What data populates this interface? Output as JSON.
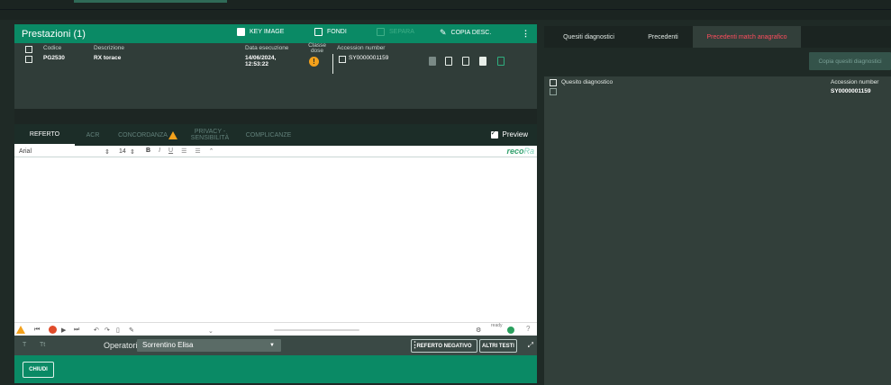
{
  "prestazioni": {
    "title": "Prestazioni (1)",
    "toolbar": {
      "key_image": "KEY IMAGE",
      "fondi": "FONDI",
      "separa": "SEPARA",
      "copia_desc": "COPIA DESC."
    },
    "columns": {
      "codice": "Codice",
      "descrizione": "Descrizione",
      "data": "Data esecuzione",
      "classe": "Classe dose",
      "accession": "Accession number"
    },
    "rows": [
      {
        "codice": "PG2530",
        "descrizione": "RX torace",
        "data": "14/06/2024, 12:53:22",
        "classe_icon": "!",
        "accession": "SY0000001159"
      }
    ]
  },
  "tabs": {
    "referto": "REFERTO",
    "acr": "ACR",
    "concordanza": "CONCORDANZA",
    "privacy": "PRIVACY - SENSIBILITÀ",
    "complicanze": "COMPLICANZE",
    "preview": "Preview"
  },
  "editor": {
    "font": "Arial",
    "font_size": "14",
    "brand": "reco",
    "brand_suffix": "Ra",
    "status_ready": "ready"
  },
  "footer": {
    "operatori_label": "Operatori",
    "operatore": "Sorrentino Elisa",
    "referto_negativo": "REFERTO NEGATIVO",
    "altri_testi": "ALTRI TESTI",
    "chiudi": "CHIUDI"
  },
  "right_panel": {
    "tabs": [
      "Quesiti diagnostici",
      "Precedenti",
      "Precedenti match anagrafico"
    ],
    "active_tab_index": 2,
    "copy_button": "Copia quesiti diagnostici",
    "columns": {
      "quesito": "Quesito diagnostico",
      "accession": "Accession number"
    },
    "rows": [
      {
        "quesito": "",
        "accession": "SY0000001159"
      }
    ]
  },
  "colors": {
    "accent_green": "#0a8a65",
    "warning": "#f3a11c",
    "active_tab_red": "#ff4d5e"
  }
}
